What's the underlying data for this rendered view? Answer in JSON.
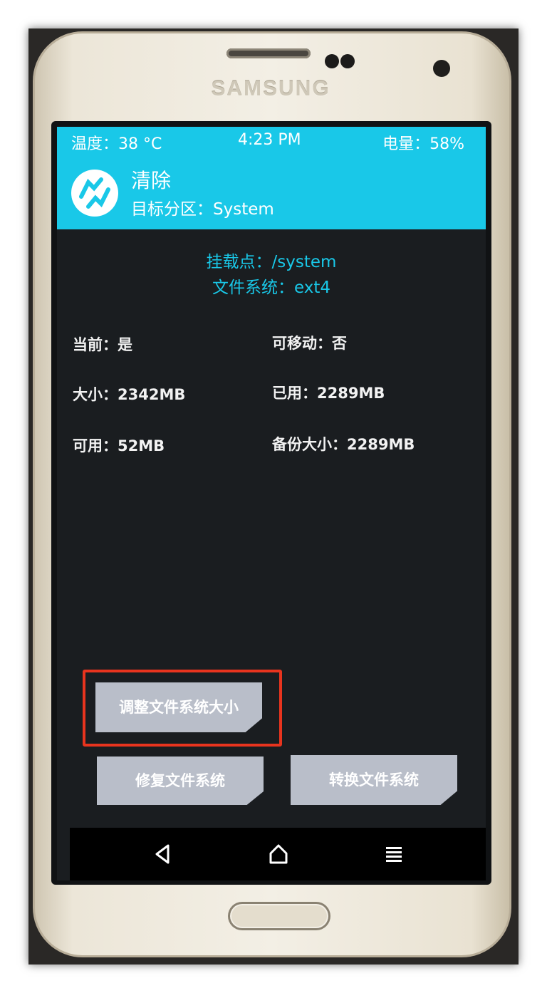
{
  "device": {
    "brand": "SAMSUNG"
  },
  "status_bar": {
    "temperature": "温度：38 °C",
    "time": "4:23 PM",
    "battery": "电量：58%"
  },
  "header": {
    "title": "清除",
    "subtitle": "目标分区：System"
  },
  "mount": {
    "mount_point": "挂载点：/system",
    "filesystem": "文件系统：ext4"
  },
  "partition_info": {
    "current": "当前：是",
    "removable": "可移动：否",
    "size": "大小：2342MB",
    "used": "已用：2289MB",
    "free": "可用：52MB",
    "backup_size": "备份大小：2289MB"
  },
  "buttons": {
    "resize": "调整文件系统大小",
    "repair": "修复文件系统",
    "change": "转换文件系统"
  },
  "colors": {
    "accent": "#19c8e8",
    "highlight_box": "#e8341e",
    "button": "#b9bec9",
    "screen_bg": "#1a1d20"
  },
  "icons": {
    "back": "back-triangle-icon",
    "home": "home-icon",
    "menu": "menu-lines-icon",
    "logo": "twrp-logo-icon"
  }
}
